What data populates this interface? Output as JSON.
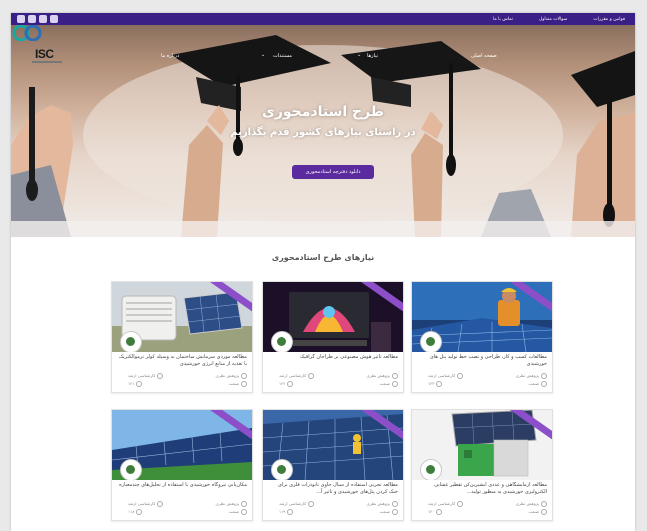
{
  "topbar": {
    "links": [
      "قوانین و مقررات",
      "سوالات متداول",
      "تماس با ما"
    ],
    "social_icons": [
      "linkedin-icon",
      "youtube-icon",
      "instagram-icon",
      "telegram-icon"
    ]
  },
  "nav": {
    "brand_logo_text": "ISC",
    "items": [
      "صفحه اصلی",
      "نیازها",
      "مستندات",
      "درباره ما"
    ]
  },
  "hero": {
    "title": "طرح استادمحوری",
    "subtitle": "در راستای نیازهای کشور قدم بگذاریم",
    "button_label": "دانلود دفترچه استادمحوری"
  },
  "section": {
    "title": "نیازهای طرح استادمحوری"
  },
  "card_meta_labels": {
    "type": "پژوهش نظری",
    "level": "کارشناسی ارشد",
    "sector": "صنعت"
  },
  "cards": [
    {
      "title": "مطالعات کسب و کار، طراحی و نصب خط تولید پنل های خورشیدی",
      "number": "۱۲۳"
    },
    {
      "title": "مطالعه تاثیر هوش مصنوعی بر طراحان گرافیک",
      "number": "۱۲۲"
    },
    {
      "title": "مطالعه موردی سرمایش ساختمان به وسیله کولر ترموالکتریک با تغذیه از منابع انرژی خورشیدی",
      "number": "۱۲۱"
    },
    {
      "title": "مطالعه آزمایشگاهی و عددی آبشیرین‌کن تقطیر غشایی الکترولیزی خورشیدی به منظور تولید...",
      "number": "۱۲۰"
    },
    {
      "title": "مطالعه تجربی استفاده از سیال حاوی نانوذرات فلزی برای خنک کردن پنل‌های خورشیدی و تاثیر آ...",
      "number": "۱۱۹"
    },
    {
      "title": "مکان‌یابی نیروگاه خورشیدی با استفاده از تحلیل‌های چندمعیاره",
      "number": "۱۱۸"
    }
  ],
  "colors": {
    "brand_purple": "#3a1f86",
    "button_purple": "#5a2a9e",
    "ribbon_purple": "#8c4fc9"
  }
}
